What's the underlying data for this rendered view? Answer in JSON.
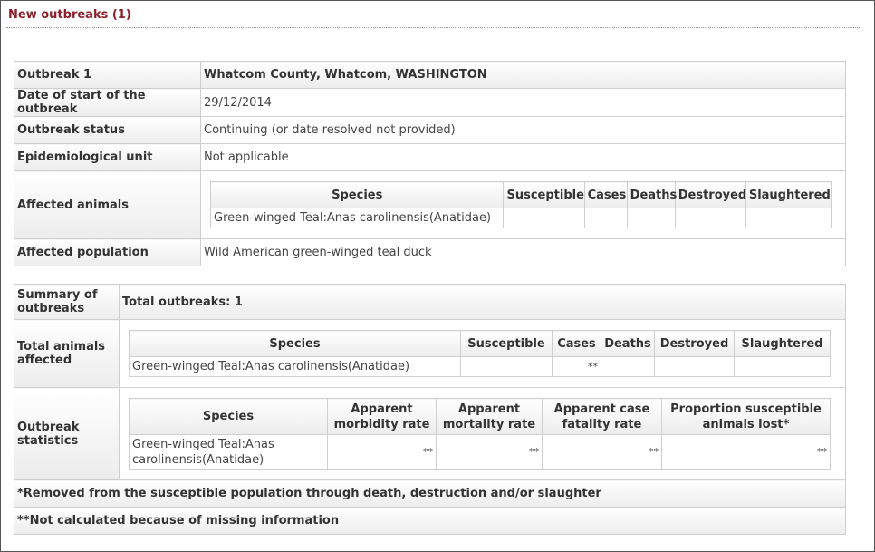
{
  "section_title": "New outbreaks (1)",
  "outbreak": {
    "rows": [
      {
        "label": "Outbreak 1",
        "value": "Whatcom County, Whatcom, WASHINGTON"
      },
      {
        "label": "Date of start of the outbreak",
        "value": "29/12/2014"
      },
      {
        "label": "Outbreak status",
        "value": "Continuing (or date resolved not provided)"
      },
      {
        "label": "Epidemiological unit",
        "value": "Not applicable"
      }
    ],
    "affected_animals_label": "Affected animals",
    "affected_animals_headers": [
      "Species",
      "Susceptible",
      "Cases",
      "Deaths",
      "Destroyed",
      "Slaughtered"
    ],
    "affected_animals_row": [
      "Green-winged Teal:Anas carolinensis(Anatidae)",
      "",
      "",
      "",
      "",
      ""
    ],
    "affected_population_label": "Affected population",
    "affected_population_value": "Wild American green-winged teal duck"
  },
  "summary": {
    "summary_label": "Summary of outbreaks",
    "total_outbreaks": "Total outbreaks: 1",
    "total_animals_label": "Total animals affected",
    "total_animals_headers": [
      "Species",
      "Susceptible",
      "Cases",
      "Deaths",
      "Destroyed",
      "Slaughtered"
    ],
    "total_animals_row": [
      "Green-winged Teal:Anas carolinensis(Anatidae)",
      "",
      "**",
      "",
      "",
      ""
    ],
    "statistics_label": "Outbreak statistics",
    "statistics_headers": [
      "Species",
      "Apparent morbidity rate",
      "Apparent mortality rate",
      "Apparent case fatality rate",
      "Proportion susceptible animals lost*"
    ],
    "statistics_row": [
      "Green-winged Teal:Anas carolinensis(Anatidae)",
      "**",
      "**",
      "**",
      "**"
    ],
    "footnote_1": "*Removed from the susceptible population through death, destruction and/or slaughter",
    "footnote_2": "**Not calculated because of missing information"
  }
}
